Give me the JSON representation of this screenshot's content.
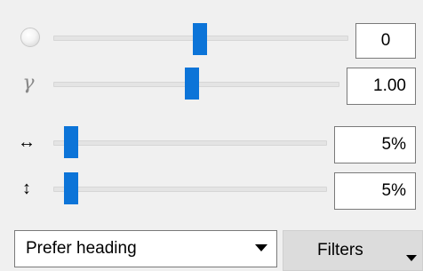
{
  "rows": [
    {
      "icon": "radio-circle-icon",
      "value": "0",
      "slider_fraction": 0.55
    },
    {
      "icon": "gamma-icon",
      "icon_glyph": "γ",
      "value": "1.00",
      "slider_fraction": 0.49
    },
    {
      "icon": "horizontal-arrows-icon",
      "icon_glyph": "↔",
      "value": "5%",
      "slider_fraction": 0.03
    },
    {
      "icon": "vertical-arrows-icon",
      "icon_glyph": "↕",
      "value": "5%",
      "slider_fraction": 0.03
    }
  ],
  "dropdown": {
    "selected": "Prefer heading"
  },
  "filters_button": {
    "label": "Filters"
  },
  "colors": {
    "accent": "#0c74d8",
    "background": "#f0f0f0"
  }
}
